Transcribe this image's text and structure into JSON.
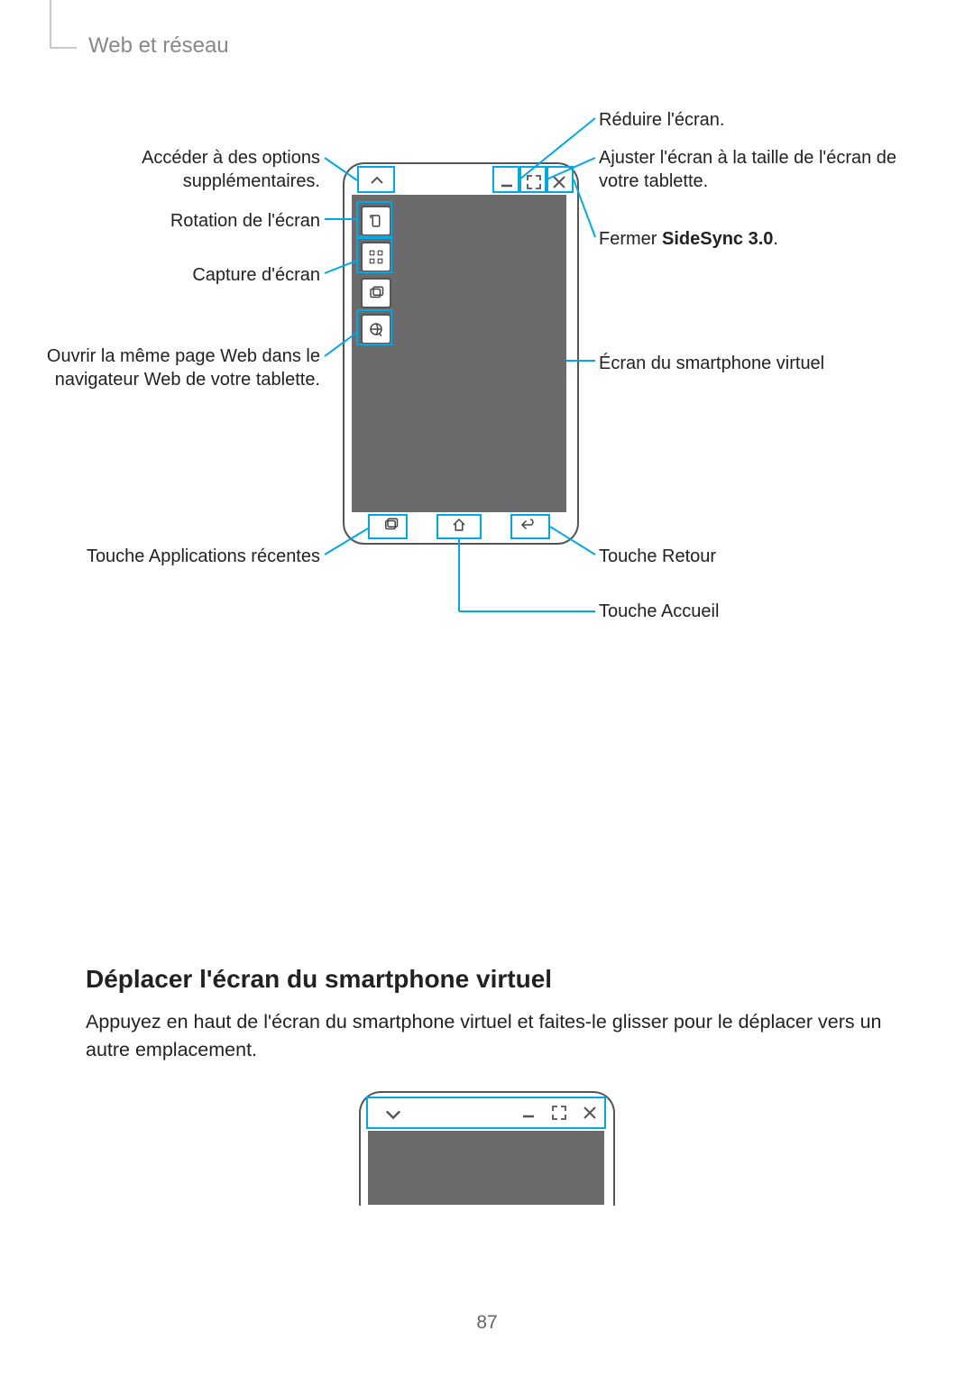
{
  "section_title": "Web et réseau",
  "page_number": "87",
  "diagram": {
    "labels": {
      "reduire": "Réduire l'écran.",
      "ajuster": "Ajuster l'écran à la taille de l'écran de votre tablette.",
      "acceder_l1": "Accéder à des options",
      "acceder_l2": "supplémentaires.",
      "rotation": "Rotation de l'écran",
      "capture": "Capture d'écran",
      "fermer_prefix": "Fermer ",
      "fermer_bold": "SideSync 3.0",
      "fermer_suffix": ".",
      "ouvrir_l1": "Ouvrir la même page Web dans le",
      "ouvrir_l2": "navigateur Web de votre tablette.",
      "ecran_virtuel": "Écran du smartphone virtuel",
      "recentes": "Touche Applications récentes",
      "retour": "Touche Retour",
      "accueil": "Touche Accueil"
    }
  },
  "sub_heading": "Déplacer l'écran du smartphone virtuel",
  "paragraph": "Appuyez en haut de l'écran du smartphone virtuel et faites-le glisser pour le déplacer vers un autre emplacement."
}
